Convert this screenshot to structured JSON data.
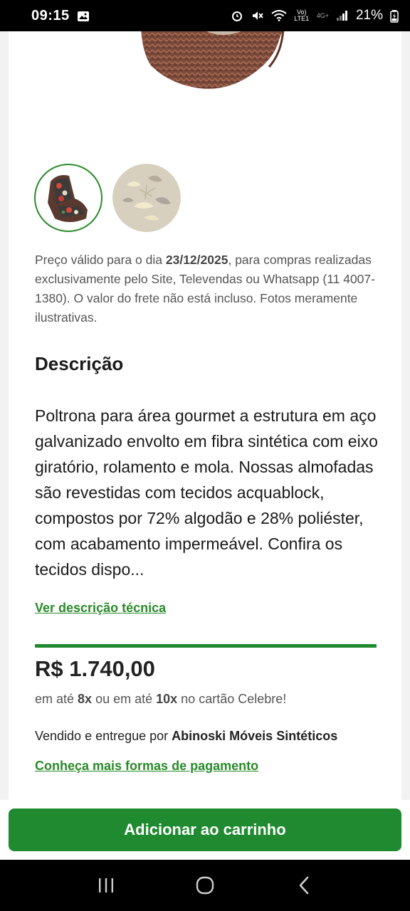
{
  "status_bar": {
    "time": "09:15",
    "network": "Vo) LTE1",
    "network_type": "4G+",
    "battery": "21%"
  },
  "product": {
    "notice_prefix": "Preço válido para o dia ",
    "notice_date": "23/12/2025",
    "notice_suffix": ", para compras realizadas exclusivamente pelo Site, Televendas ou Whatsapp (11 4007-1380). O valor do frete não está incluso. Fotos meramente ilustrativas.",
    "description_title": "Descrição",
    "description_text": "Poltrona para área gourmet  a estrutura em aço galvanizado envolto em fibra sintética com eixo giratório, rolamento e mola. Nossas almofadas são revestidas com tecidos acquablock, compostos por 72% algodão e 28% poliéster, com acabamento impermeável. Confira os tecidos dispo...",
    "tech_description_link": "Ver descrição técnica",
    "price": "R$ 1.740,00",
    "installments_prefix": "em até ",
    "installments_8x": "8x",
    "installments_middle": " ou em até ",
    "installments_10x": "10x",
    "installments_suffix": " no cartão Celebre!",
    "seller_prefix": "Vendido e entregue por ",
    "seller_name": "Abinoski Móveis Sintéticos",
    "payments_link": "Conheça mais formas de pagamento"
  },
  "actions": {
    "add_to_cart": "Adicionar ao carrinho"
  },
  "icons": {
    "gallery": "image-icon",
    "alarm": "alarm-icon",
    "mute": "mute-icon",
    "wifi": "wifi-icon",
    "signal": "signal-icon",
    "battery": "battery-charging-icon",
    "nav_recents": "recents-icon",
    "nav_home": "home-icon",
    "nav_back": "back-icon"
  },
  "colors": {
    "accent": "#1f8a2f",
    "link": "#2a8a2a"
  }
}
